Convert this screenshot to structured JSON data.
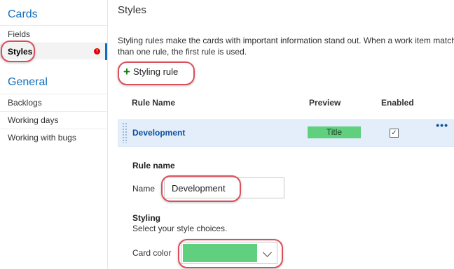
{
  "sidebar": {
    "cards_title": "Cards",
    "cards_items": [
      "Fields",
      "Styles"
    ],
    "general_title": "General",
    "general_items": [
      "Backlogs",
      "Working days",
      "Working with bugs"
    ],
    "error_badge": "!"
  },
  "main": {
    "title": "Styles",
    "description_line1": "Styling rules make the cards with important information stand out. When a work item match",
    "description_line2": "than one rule, the first rule is used.",
    "add_rule_label": "Styling rule",
    "table": {
      "headers": [
        "Rule Name",
        "Preview",
        "Enabled"
      ],
      "rows": [
        {
          "name": "Development",
          "preview": "Title",
          "enabled": "☑"
        }
      ]
    },
    "more_menu": "•••",
    "rule_name_section": "Rule name",
    "name_label": "Name",
    "name_value": "Development",
    "styling_section": "Styling",
    "styling_subtext": "Select your style choices.",
    "card_color_label": "Card color"
  },
  "colors": {
    "accent": "#106ebe",
    "card_color": "#60d07f",
    "callout": "#d9505a",
    "selected_row": "#e4eefb"
  }
}
